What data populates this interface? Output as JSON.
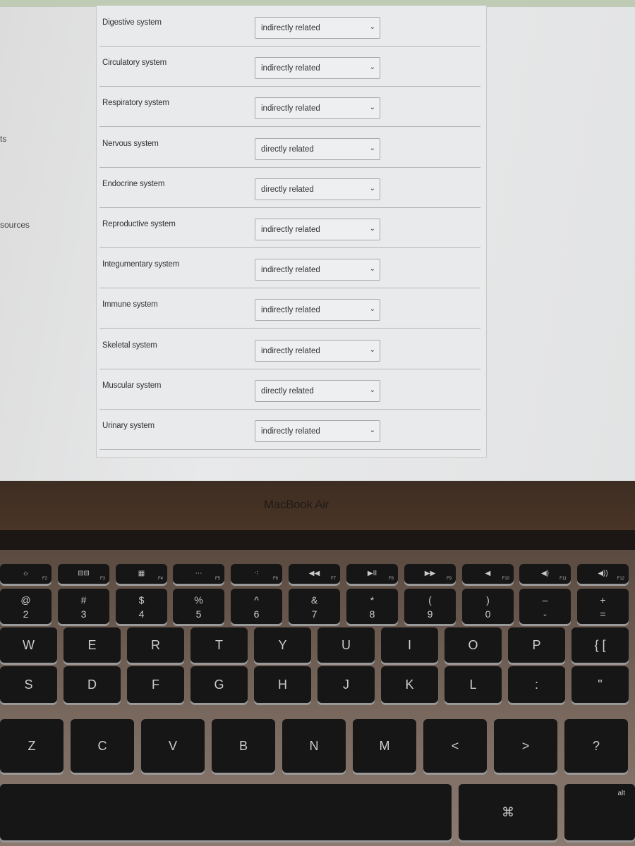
{
  "sidebar": {
    "items": [
      {
        "label": "ts"
      },
      {
        "label": "sources"
      }
    ]
  },
  "form": {
    "rows": [
      {
        "system": "Digestive system",
        "answer": "indirectly related"
      },
      {
        "system": "Circulatory system",
        "answer": "indirectly related"
      },
      {
        "system": "Respiratory system",
        "answer": "indirectly related"
      },
      {
        "system": "Nervous system",
        "answer": "directly related"
      },
      {
        "system": "Endocrine system",
        "answer": "directly related"
      },
      {
        "system": "Reproductive system",
        "answer": "indirectly related"
      },
      {
        "system": "Integumentary system",
        "answer": "indirectly related"
      },
      {
        "system": "Immune system",
        "answer": "indirectly related"
      },
      {
        "system": "Skeletal system",
        "answer": "indirectly related"
      },
      {
        "system": "Muscular system",
        "answer": "directly related"
      },
      {
        "system": "Urinary system",
        "answer": "indirectly related"
      }
    ],
    "chevron_icon": "chevron-down-icon"
  },
  "laptop": {
    "brand": "MacBook Air"
  },
  "keyboard": {
    "function_row": [
      {
        "icon": "☼",
        "f": "F2"
      },
      {
        "icon": "⊟⊟",
        "f": "F3"
      },
      {
        "icon": "▦",
        "f": "F4"
      },
      {
        "icon": "⋯",
        "f": "F5"
      },
      {
        "icon": "⁖",
        "f": "F6"
      },
      {
        "icon": "◀◀",
        "f": "F7"
      },
      {
        "icon": "▶II",
        "f": "F8"
      },
      {
        "icon": "▶▶",
        "f": "F9"
      },
      {
        "icon": "◀",
        "f": "F10"
      },
      {
        "icon": "◀)",
        "f": "F11"
      },
      {
        "icon": "◀))",
        "f": "F12"
      }
    ],
    "number_row": [
      {
        "top": "@",
        "bottom": "2"
      },
      {
        "top": "#",
        "bottom": "3"
      },
      {
        "top": "$",
        "bottom": "4"
      },
      {
        "top": "%",
        "bottom": "5"
      },
      {
        "top": "^",
        "bottom": "6"
      },
      {
        "top": "&",
        "bottom": "7"
      },
      {
        "top": "*",
        "bottom": "8"
      },
      {
        "top": "(",
        "bottom": "9"
      },
      {
        "top": ")",
        "bottom": "0"
      },
      {
        "top": "–",
        "bottom": "-"
      },
      {
        "top": "+",
        "bottom": "="
      }
    ],
    "qwerty_row": [
      "W",
      "E",
      "R",
      "T",
      "Y",
      "U",
      "I",
      "O",
      "P",
      "{ ["
    ],
    "home_row": [
      "S",
      "D",
      "F",
      "G",
      "H",
      "J",
      "K",
      "L",
      ":",
      "\""
    ],
    "bottom_row": [
      "Z",
      "C",
      "V",
      "B",
      "N",
      "M",
      "<",
      ">",
      "?"
    ],
    "space_row": [
      "",
      "⌘",
      "alt"
    ]
  }
}
